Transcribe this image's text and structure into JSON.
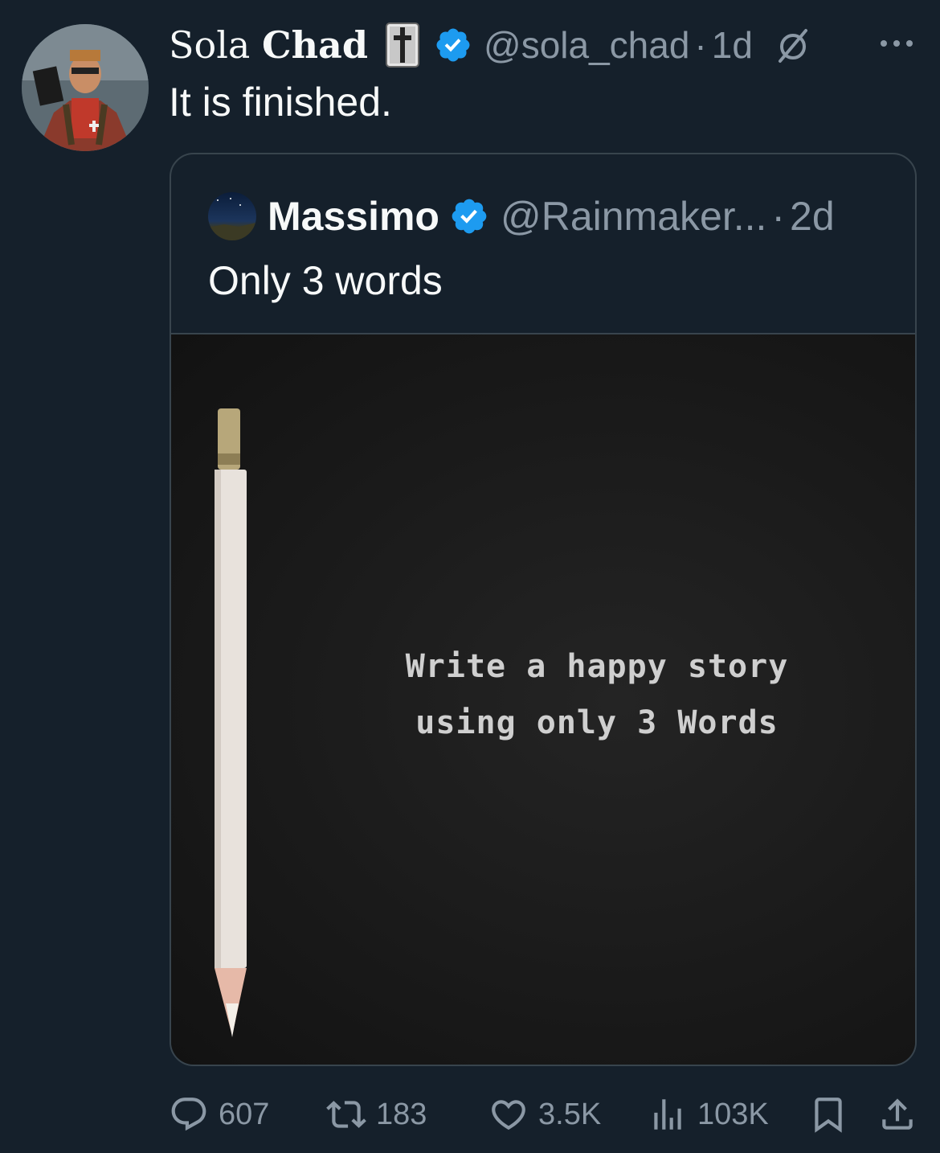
{
  "tweet": {
    "display_name_regular": "Sola ",
    "display_name_bold": "Chad",
    "handle": "@sola_chad",
    "dot": "·",
    "time": "1d",
    "text": "It is finished."
  },
  "quoted_tweet": {
    "name": "Massimo",
    "handle": "@Rainmaker...",
    "dot": "·",
    "time": "2d",
    "text": "Only 3 words",
    "image_text_line1": "Write a happy story",
    "image_text_line2": "using only 3 Words"
  },
  "actions": {
    "replies": "607",
    "reposts": "183",
    "likes": "3.5K",
    "views": "103K"
  },
  "icons": [
    "cross-icon",
    "verified-icon",
    "slash-icon",
    "more-icon",
    "reply-icon",
    "repost-icon",
    "like-icon",
    "views-icon",
    "bookmark-icon",
    "share-icon"
  ],
  "colors": {
    "background": "#15202b",
    "verified": "#1d9bf0",
    "muted": "#8b98a5",
    "border": "#38444d"
  }
}
